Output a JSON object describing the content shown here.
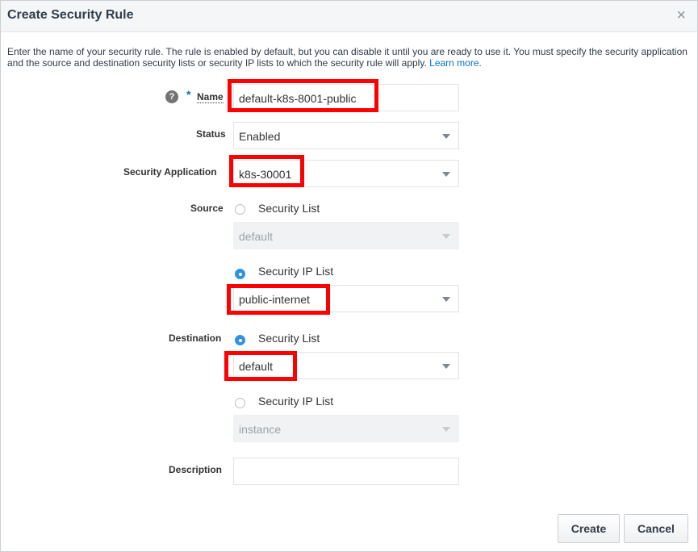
{
  "dialog": {
    "title": "Create Security Rule",
    "close_glyph": "×",
    "intro_text": "Enter the name of your security rule. The rule is enabled by default, but you can disable it until you are ready to use it. You must specify the security application and the source and destination security lists or security IP lists to which the security rule will apply.",
    "learn_more": "Learn more."
  },
  "form": {
    "help_glyph": "?",
    "required_mark": "*",
    "name": {
      "label": "Name",
      "value": "default-k8s-8001-public"
    },
    "status": {
      "label": "Status",
      "value": "Enabled"
    },
    "security_application": {
      "label": "Security Application",
      "value": "k8s-30001"
    },
    "source": {
      "label": "Source",
      "option_security_list": "Security List",
      "security_list_value": "default",
      "option_security_ip_list": "Security IP List",
      "security_ip_list_value": "public-internet",
      "selected": "Security IP List"
    },
    "destination": {
      "label": "Destination",
      "option_security_list": "Security List",
      "security_list_value": "default",
      "option_security_ip_list": "Security IP List",
      "security_ip_list_value": "instance",
      "selected": "Security List"
    },
    "description": {
      "label": "Description",
      "value": ""
    }
  },
  "buttons": {
    "create": "Create",
    "cancel": "Cancel"
  },
  "colors": {
    "highlight": "#ff0000",
    "accent": "#0572ce",
    "radio_selected": "#2e93e6"
  }
}
